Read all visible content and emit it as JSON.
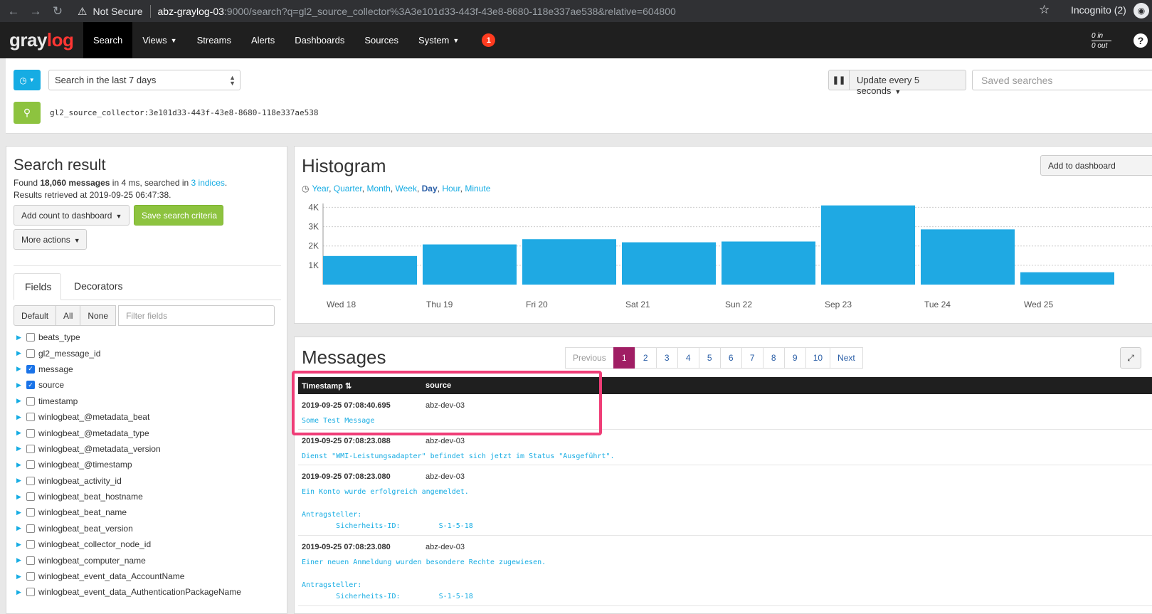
{
  "browser": {
    "security_label": "Not Secure",
    "url_host": "abz-graylog-03",
    "url_path": ":9000/search?q=gl2_source_collector%3A3e101d33-443f-43e8-8680-118e337ae538&relative=604800",
    "incognito_label": "Incognito (2)"
  },
  "navbar": {
    "logo_gray": "gray",
    "logo_log": "log",
    "items": [
      {
        "label": "Search",
        "active": true
      },
      {
        "label": "Views",
        "dropdown": true
      },
      {
        "label": "Streams"
      },
      {
        "label": "Alerts"
      },
      {
        "label": "Dashboards"
      },
      {
        "label": "Sources"
      },
      {
        "label": "System",
        "dropdown": true
      }
    ],
    "notification_count": "1",
    "throughput_in": "0 in",
    "throughput_out": "0 out"
  },
  "searchbar": {
    "range": "Search in the last 7 days",
    "refresh": "Update every 5 seconds",
    "saved_searches_placeholder": "Saved searches",
    "query": "gl2_source_collector:3e101d33-443f-43e8-8680-118e337ae538"
  },
  "result": {
    "title": "Search result",
    "found_prefix": "Found ",
    "message_count": "18,060 messages",
    "found_middle": " in 4 ms, searched in ",
    "indices": "3 indices",
    "found_suffix": ".",
    "retrieved": "Results retrieved at 2019-09-25 06:47:38.",
    "add_count_label": "Add count to dashboard",
    "save_criteria_label": "Save search criteria",
    "more_actions_label": "More actions",
    "tabs": [
      "Fields",
      "Decorators"
    ],
    "filter_buttons": [
      "Default",
      "All",
      "None"
    ],
    "filter_placeholder": "Filter fields",
    "fields": [
      {
        "name": "beats_type",
        "checked": false
      },
      {
        "name": "gl2_message_id",
        "checked": false
      },
      {
        "name": "message",
        "checked": true
      },
      {
        "name": "source",
        "checked": true
      },
      {
        "name": "timestamp",
        "checked": false
      },
      {
        "name": "winlogbeat_@metadata_beat",
        "checked": false
      },
      {
        "name": "winlogbeat_@metadata_type",
        "checked": false
      },
      {
        "name": "winlogbeat_@metadata_version",
        "checked": false
      },
      {
        "name": "winlogbeat_@timestamp",
        "checked": false
      },
      {
        "name": "winlogbeat_activity_id",
        "checked": false
      },
      {
        "name": "winlogbeat_beat_hostname",
        "checked": false
      },
      {
        "name": "winlogbeat_beat_name",
        "checked": false
      },
      {
        "name": "winlogbeat_beat_version",
        "checked": false
      },
      {
        "name": "winlogbeat_collector_node_id",
        "checked": false
      },
      {
        "name": "winlogbeat_computer_name",
        "checked": false
      },
      {
        "name": "winlogbeat_event_data_AccountName",
        "checked": false
      },
      {
        "name": "winlogbeat_event_data_AuthenticationPackageName",
        "checked": false
      }
    ]
  },
  "histogram": {
    "title": "Histogram",
    "resolutions": [
      "Year",
      "Quarter",
      "Month",
      "Week",
      "Day",
      "Hour",
      "Minute"
    ],
    "selected_resolution": "Day",
    "add_to_dashboard_label": "Add to dashboard"
  },
  "chart_data": {
    "type": "bar",
    "categories": [
      "Wed 18",
      "Thu 19",
      "Fri 20",
      "Sat 21",
      "Sun 22",
      "Sep 23",
      "Tue 24",
      "Wed 25"
    ],
    "values": [
      1480,
      2080,
      2350,
      2190,
      2230,
      4100,
      2860,
      640
    ],
    "y_ticks": [
      "1K",
      "2K",
      "3K",
      "4K"
    ],
    "y_tick_values": [
      1000,
      2000,
      3000,
      4000
    ],
    "ylim": [
      0,
      4200
    ],
    "bar_color": "#1fa9e3",
    "grid": true
  },
  "messages": {
    "title": "Messages",
    "pager": [
      "Previous",
      "1",
      "2",
      "3",
      "4",
      "5",
      "6",
      "7",
      "8",
      "9",
      "10",
      "Next"
    ],
    "columns": [
      "Timestamp",
      "source"
    ],
    "rows": [
      {
        "timestamp": "2019-09-25 07:08:40.695",
        "source": "abz-dev-03",
        "message": "Some Test Message"
      },
      {
        "timestamp": "2019-09-25 07:08:23.088",
        "source": "abz-dev-03",
        "message": "Dienst \"WMI-Leistungsadapter\" befindet sich jetzt im Status \"Ausgeführt\"."
      },
      {
        "timestamp": "2019-09-25 07:08:23.080",
        "source": "abz-dev-03",
        "message": "Ein Konto wurde erfolgreich angemeldet.\n\nAntragsteller:\n\tSicherheits-ID:\t\tS-1-5-18"
      },
      {
        "timestamp": "2019-09-25 07:08:23.080",
        "source": "abz-dev-03",
        "message": "Einer neuen Anmeldung wurden besondere Rechte zugewiesen.\n\nAntragsteller:\n\tSicherheits-ID:\t\tS-1-5-18"
      }
    ]
  },
  "colors": {
    "accent": "#16ace3",
    "success": "#8dc33f",
    "active_page": "#a01e64",
    "highlight": "#ef3d77"
  }
}
